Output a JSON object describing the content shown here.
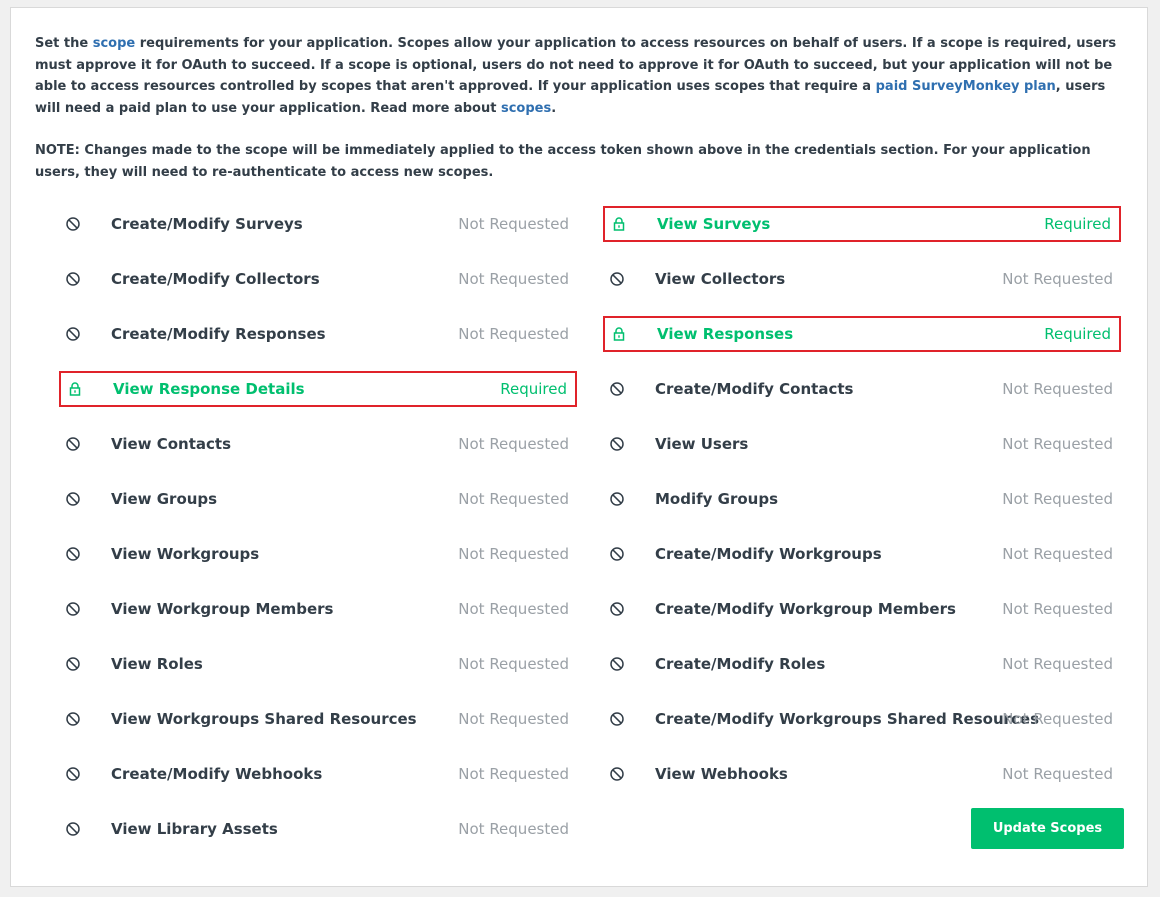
{
  "intro": {
    "t1": "Set the ",
    "link_scope": "scope",
    "t2": " requirements for your application. Scopes allow your application to access resources on behalf of users. If a scope is required, users must approve it for OAuth to succeed. If a scope is optional, users do not need to approve it for OAuth to succeed, but your application will not be able to access resources controlled by scopes that aren't approved. If your application uses scopes that require a ",
    "link_paid_plan": "paid SurveyMonkey plan",
    "t3": ", users will need a paid plan to use your application. Read more about ",
    "link_scopes": "scopes",
    "t4": "."
  },
  "note": "NOTE: Changes made to the scope will be immediately applied to the access token shown above in the credentials section. For your application users, they will need to re-authenticate to access new scopes.",
  "colors": {
    "required": "#00bf6f",
    "not_requested": "#9aa0a6",
    "highlight": "#e0232a",
    "link": "#2f6fb0"
  },
  "scopes_left": [
    {
      "name": "Create/Modify Surveys",
      "status": "Not Requested",
      "required": false,
      "icon": "block-icon"
    },
    {
      "name": "Create/Modify Collectors",
      "status": "Not Requested",
      "required": false,
      "icon": "block-icon"
    },
    {
      "name": "Create/Modify Responses",
      "status": "Not Requested",
      "required": false,
      "icon": "block-icon"
    },
    {
      "name": "View Response Details",
      "status": "Required",
      "required": true,
      "icon": "lock-icon"
    },
    {
      "name": "View Contacts",
      "status": "Not Requested",
      "required": false,
      "icon": "block-icon"
    },
    {
      "name": "View Groups",
      "status": "Not Requested",
      "required": false,
      "icon": "block-icon"
    },
    {
      "name": "View Workgroups",
      "status": "Not Requested",
      "required": false,
      "icon": "block-icon"
    },
    {
      "name": "View Workgroup Members",
      "status": "Not Requested",
      "required": false,
      "icon": "block-icon"
    },
    {
      "name": "View Roles",
      "status": "Not Requested",
      "required": false,
      "icon": "block-icon"
    },
    {
      "name": "View Workgroups Shared Resources",
      "status": "Not Requested",
      "required": false,
      "icon": "block-icon"
    },
    {
      "name": "Create/Modify Webhooks",
      "status": "Not Requested",
      "required": false,
      "icon": "block-icon"
    },
    {
      "name": "View Library Assets",
      "status": "Not Requested",
      "required": false,
      "icon": "block-icon"
    }
  ],
  "scopes_right": [
    {
      "name": "View Surveys",
      "status": "Required",
      "required": true,
      "icon": "lock-icon"
    },
    {
      "name": "View Collectors",
      "status": "Not Requested",
      "required": false,
      "icon": "block-icon"
    },
    {
      "name": "View Responses",
      "status": "Required",
      "required": true,
      "icon": "lock-icon"
    },
    {
      "name": "Create/Modify Contacts",
      "status": "Not Requested",
      "required": false,
      "icon": "block-icon"
    },
    {
      "name": "View Users",
      "status": "Not Requested",
      "required": false,
      "icon": "block-icon"
    },
    {
      "name": "Modify Groups",
      "status": "Not Requested",
      "required": false,
      "icon": "block-icon"
    },
    {
      "name": "Create/Modify Workgroups",
      "status": "Not Requested",
      "required": false,
      "icon": "block-icon"
    },
    {
      "name": "Create/Modify Workgroup Members",
      "status": "Not Requested",
      "required": false,
      "icon": "block-icon"
    },
    {
      "name": "Create/Modify Roles",
      "status": "Not Requested",
      "required": false,
      "icon": "block-icon"
    },
    {
      "name": "Create/Modify Workgroups Shared Resources",
      "status": "Not Requested",
      "required": false,
      "icon": "block-icon"
    },
    {
      "name": "View Webhooks",
      "status": "Not Requested",
      "required": false,
      "icon": "block-icon"
    }
  ],
  "update_button_label": "Update Scopes"
}
